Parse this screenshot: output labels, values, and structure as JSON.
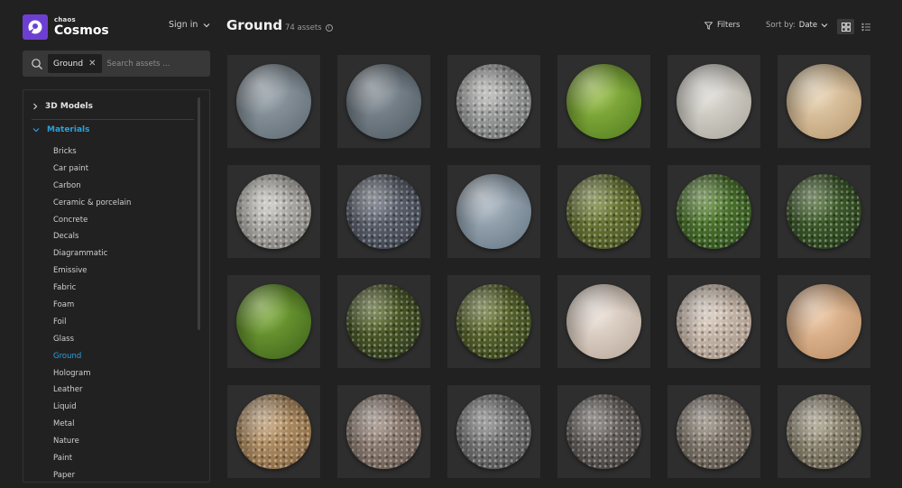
{
  "brand": {
    "small": "chaos",
    "name": "Cosmos",
    "color": "#6d3fd1"
  },
  "header": {
    "signin": "Sign in"
  },
  "search": {
    "chip": "Ground",
    "placeholder": "Search assets ..."
  },
  "tree": {
    "models_label": "3D Models",
    "materials_label": "Materials",
    "accent": "#2aa2dc",
    "items": [
      "Bricks",
      "Car paint",
      "Carbon",
      "Ceramic & porcelain",
      "Concrete",
      "Decals",
      "Diagrammatic",
      "Emissive",
      "Fabric",
      "Foam",
      "Foil",
      "Glass",
      "Ground",
      "Hologram",
      "Leather",
      "Liquid",
      "Metal",
      "Nature",
      "Paint",
      "Paper"
    ],
    "active_item": "Ground"
  },
  "main": {
    "title": "Ground",
    "count": "74 assets",
    "filters": "Filters",
    "sort_label": "Sort by:",
    "sort_value": "Date",
    "view_mode": "grid"
  },
  "assets": [
    {
      "colors": [
        "#9aa5ad",
        "#5c6870"
      ],
      "speckle": false
    },
    {
      "colors": [
        "#8a949c",
        "#4e5a63"
      ],
      "speckle": false
    },
    {
      "colors": [
        "#c2c2c0",
        "#5f6263"
      ],
      "speckle": true
    },
    {
      "colors": [
        "#9bc14a",
        "#4d7a1c"
      ],
      "speckle": false
    },
    {
      "colors": [
        "#e4e2dc",
        "#a8a49a"
      ],
      "speckle": false
    },
    {
      "colors": [
        "#ecd7b6",
        "#b5966d"
      ],
      "speckle": false
    },
    {
      "colors": [
        "#d5d3cd",
        "#6d6a66"
      ],
      "speckle": true
    },
    {
      "colors": [
        "#6e7480",
        "#353a44"
      ],
      "speckle": true
    },
    {
      "colors": [
        "#aebbc6",
        "#637481"
      ],
      "speckle": false
    },
    {
      "colors": [
        "#7d8a3e",
        "#3e4a1d"
      ],
      "speckle": true
    },
    {
      "colors": [
        "#5e8b35",
        "#27451a"
      ],
      "speckle": true
    },
    {
      "colors": [
        "#4d6e33",
        "#1f3417"
      ],
      "speckle": true
    },
    {
      "colors": [
        "#7fae3a",
        "#3b5f1a"
      ],
      "speckle": false
    },
    {
      "colors": [
        "#5f6f2c",
        "#25301a"
      ],
      "speckle": true
    },
    {
      "colors": [
        "#6e7a33",
        "#2d3a19"
      ],
      "speckle": true
    },
    {
      "colors": [
        "#efe4da",
        "#b5a598"
      ],
      "speckle": false
    },
    {
      "colors": [
        "#e0d2c4",
        "#9c8a7c"
      ],
      "speckle": true
    },
    {
      "colors": [
        "#efc8a4",
        "#b88b63"
      ],
      "speckle": false
    },
    {
      "colors": [
        "#c8a374",
        "#7d5e3b"
      ],
      "speckle": true
    },
    {
      "colors": [
        "#a69488",
        "#5e5048"
      ],
      "speckle": true
    },
    {
      "colors": [
        "#8f8f8f",
        "#474747"
      ],
      "speckle": true
    },
    {
      "colors": [
        "#7d7773",
        "#3a3734"
      ],
      "speckle": true
    },
    {
      "colors": [
        "#9c9285",
        "#4f473e"
      ],
      "speckle": true
    },
    {
      "colors": [
        "#b0a890",
        "#514a3b"
      ],
      "speckle": true
    }
  ]
}
